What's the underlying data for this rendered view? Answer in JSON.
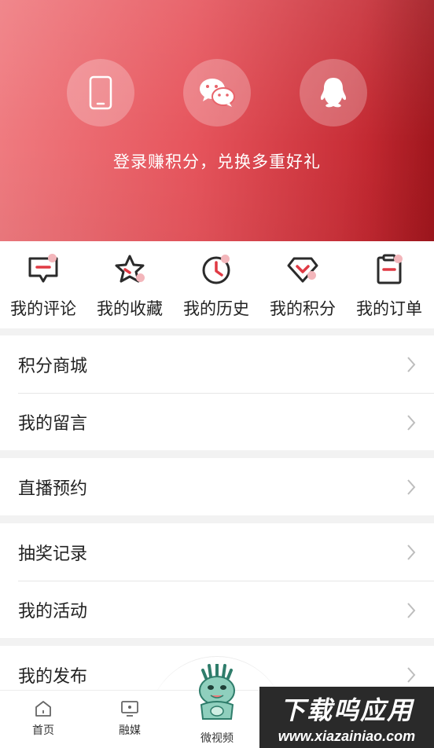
{
  "hero": {
    "login_methods": [
      {
        "name": "phone",
        "icon": "phone-icon"
      },
      {
        "name": "wechat",
        "icon": "wechat-icon"
      },
      {
        "name": "qq",
        "icon": "qq-icon"
      }
    ],
    "tagline": "登录赚积分，兑换多重好礼"
  },
  "quick_actions": [
    {
      "label": "我的评论",
      "icon": "comment-icon"
    },
    {
      "label": "我的收藏",
      "icon": "star-icon"
    },
    {
      "label": "我的历史",
      "icon": "clock-icon"
    },
    {
      "label": "我的积分",
      "icon": "diamond-icon"
    },
    {
      "label": "我的订单",
      "icon": "clipboard-icon"
    }
  ],
  "menu": {
    "group1": [
      "积分商城",
      "我的留言"
    ],
    "group2": [
      "直播预约"
    ],
    "group3": [
      "抽奖记录",
      "我的活动"
    ],
    "group4": [
      "我的发布"
    ]
  },
  "tabbar": {
    "tabs": [
      {
        "label": "首页",
        "icon": "home-icon"
      },
      {
        "label": "融媒",
        "icon": "tv-icon"
      },
      {
        "label": "微视频",
        "icon": "mascot-icon"
      }
    ]
  },
  "watermark": {
    "title": "下载呜应用",
    "url": "www.xiazainiao.com"
  },
  "colors": {
    "accent": "#e03a44",
    "dot": "#f3b6bb"
  }
}
